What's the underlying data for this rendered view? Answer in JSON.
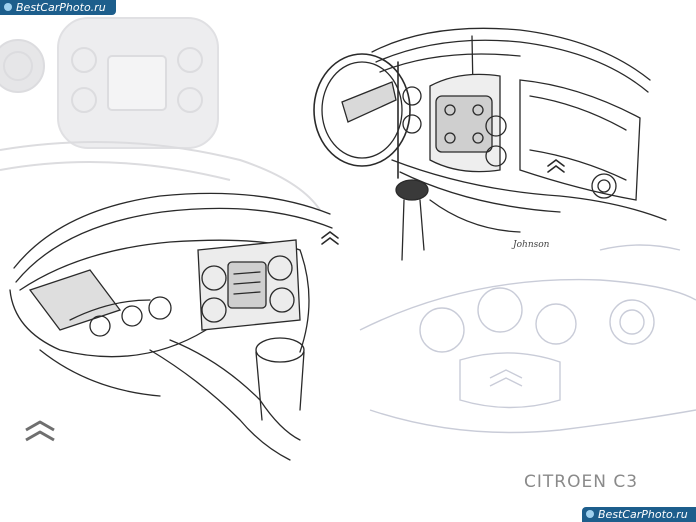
{
  "watermark_top": "BestCarPhoto.ru",
  "watermark_bottom": "BestCarPhoto.ru",
  "signature": "Johnson",
  "brand_wordmark": "CITROEN C3",
  "colors": {
    "ink": "#2a2a2a",
    "faint_ink": "#c9ccd8",
    "panel_grey": "#e4e4e6",
    "watermark_bg": "#1d5e8c"
  },
  "icons": [
    "citroen-chevron-icon"
  ]
}
